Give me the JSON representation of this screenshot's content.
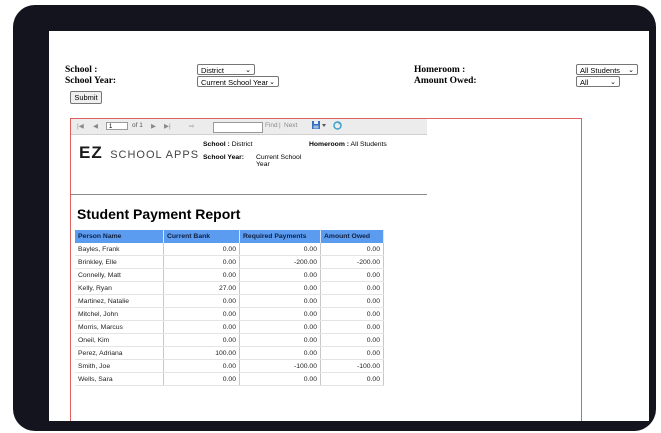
{
  "filters": {
    "school_label": "School :",
    "school_value": "District",
    "school_year_label": "School Year:",
    "school_year_value": "Current School Year",
    "homeroom_label": "Homeroom :",
    "homeroom_value": "All Students",
    "amount_owed_label": "Amount Owed:",
    "amount_owed_value": "All",
    "submit_label": "Submit"
  },
  "toolbar": {
    "first_icon": "first-page-icon",
    "prev_icon": "prev-page-icon",
    "page_value": "1",
    "of_text": "of 1",
    "next_icon": "next-page-icon",
    "last_icon": "last-page-icon",
    "back_icon": "back-icon",
    "find_label": "Find",
    "separator": "|",
    "next_label": "Next",
    "export_icon": "export-icon",
    "refresh_icon": "refresh-icon"
  },
  "report": {
    "logo_main": "EZ",
    "logo_sub": "SCHOOL APPS",
    "school_label": "School :",
    "school_value": "District",
    "school_year_label": "School Year:",
    "school_year_value": "Current School Year",
    "homeroom_label": "Homeroom :",
    "homeroom_value": "All Students",
    "title": "Student Payment Report",
    "columns": [
      "Person Name",
      "Current Bank",
      "Required Payments",
      "Amount Owed"
    ],
    "rows": [
      [
        "Bayles, Frank",
        "0.00",
        "0.00",
        "0.00"
      ],
      [
        "Brinkley, Elle",
        "0.00",
        "-200.00",
        "-200.00"
      ],
      [
        "Connelly, Matt",
        "0.00",
        "0.00",
        "0.00"
      ],
      [
        "Kelly, Ryan",
        "27.00",
        "0.00",
        "0.00"
      ],
      [
        "Martinez, Natalie",
        "0.00",
        "0.00",
        "0.00"
      ],
      [
        "Mitchel, John",
        "0.00",
        "0.00",
        "0.00"
      ],
      [
        "Morris, Marcus",
        "0.00",
        "0.00",
        "0.00"
      ],
      [
        "Oneil, Kim",
        "0.00",
        "0.00",
        "0.00"
      ],
      [
        "Perez, Adriana",
        "100.00",
        "0.00",
        "0.00"
      ],
      [
        "Smith, Joe",
        "0.00",
        "-100.00",
        "-100.00"
      ],
      [
        "Wells, Sara",
        "0.00",
        "0.00",
        "0.00"
      ]
    ]
  },
  "colors": {
    "header_blue": "#5b9bf0",
    "frame": "#14141e",
    "viewer_border": "#e06060"
  }
}
